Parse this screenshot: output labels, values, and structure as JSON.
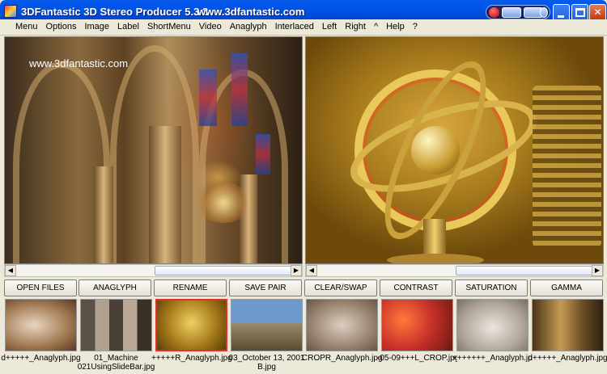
{
  "window": {
    "title": "3DFantastic 3D Stereo Producer 5.3.3",
    "url": "www.3dfantastic.com"
  },
  "menu": [
    "Menu",
    "Options",
    "Image",
    "Label",
    "ShortMenu",
    "Video",
    "Anaglyph",
    "Interlaced",
    "Left",
    "Right",
    "^",
    "Help",
    "?"
  ],
  "left_pane": {
    "watermark": "www.3dfantastic.com"
  },
  "buttons": [
    "OPEN FILES",
    "ANAGLYPH",
    "RENAME",
    "SAVE PAIR",
    "CLEAR/SWAP",
    "CONTRAST",
    "SATURATION",
    "GAMMA"
  ],
  "thumbnails": [
    {
      "label": "d+++++_Anaglyph.jpg",
      "label2": ""
    },
    {
      "label": "01_Machine",
      "label2": "021UsingSlideBar.jpg"
    },
    {
      "label": "+++++R_Anaglyph.jpg",
      "label2": ""
    },
    {
      "label": "03_October 13, 2001",
      "label2": "B.jpg"
    },
    {
      "label": "CROPR_Anaglyph.jpg",
      "label2": ""
    },
    {
      "label": "-05-09+++L_CROP.jpg",
      "label2": ""
    },
    {
      "label": "+++++++_Anaglyph.jpg",
      "label2": ""
    },
    {
      "label": "d+++++_Anaglyph.jpg",
      "label2": ""
    }
  ],
  "selected_thumbnail": 2,
  "colors": {
    "titlebar": "#0050e0",
    "selection": "#e03030"
  }
}
